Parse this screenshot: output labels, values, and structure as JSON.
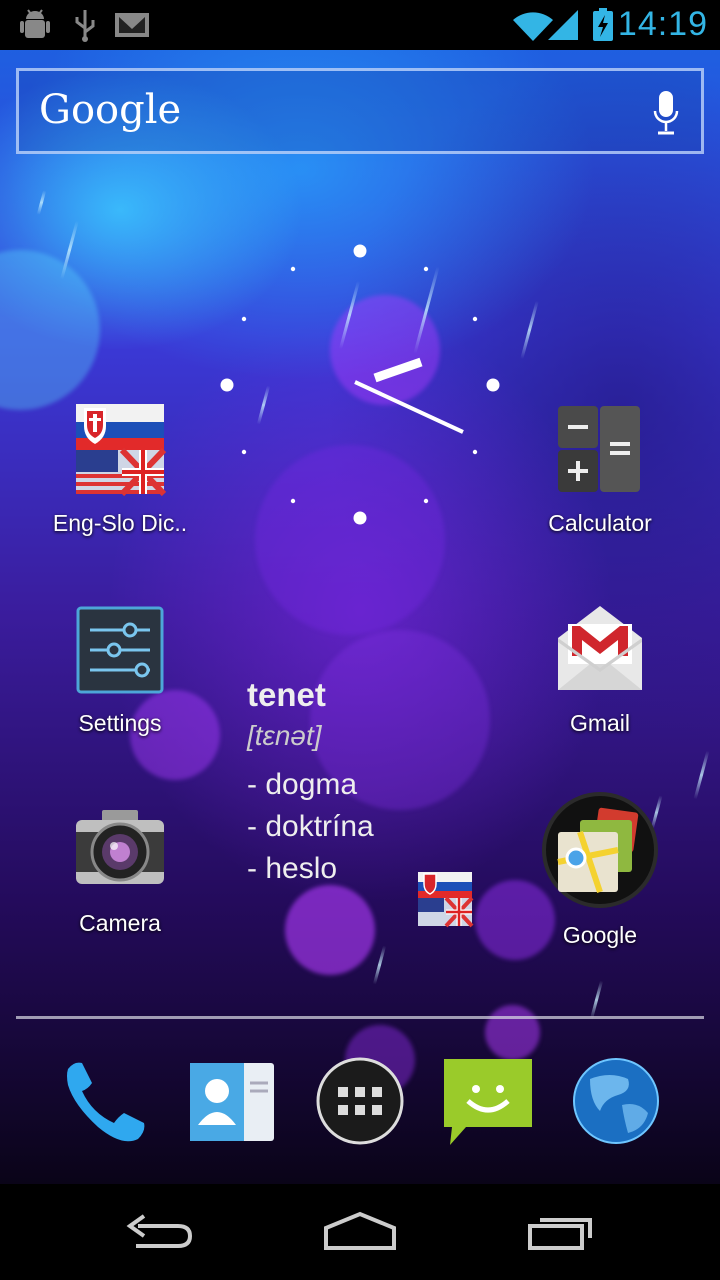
{
  "status_bar": {
    "time": "14:19",
    "left_icons": [
      "android-debug-icon",
      "usb-icon",
      "gmail-notification-icon"
    ],
    "right_icons": [
      "wifi-icon",
      "signal-icon",
      "battery-charging-icon"
    ],
    "accent_color": "#33b5e5"
  },
  "search": {
    "logo_text": "Google",
    "mic_icon": "microphone-icon"
  },
  "home_apps": [
    {
      "label": "Eng-Slo Dic..",
      "icon": "flag-dictionary-icon"
    },
    {
      "label": "Calculator",
      "icon": "calculator-icon"
    },
    {
      "label": "Settings",
      "icon": "settings-sliders-icon"
    },
    {
      "label": "Gmail",
      "icon": "gmail-envelope-icon"
    },
    {
      "label": "Camera",
      "icon": "camera-icon"
    },
    {
      "label": "Google",
      "icon": "google-folder-icon"
    }
  ],
  "dictionary_widget": {
    "word": "tenet",
    "pronunciation": "[tɛnət]",
    "translations": [
      "- dogma",
      "- doktrína",
      "- heslo"
    ]
  },
  "dock": [
    "phone-icon",
    "contacts-icon",
    "app-drawer-icon",
    "messaging-icon",
    "browser-globe-icon"
  ],
  "navigation": [
    "back-icon",
    "home-icon",
    "recent-apps-icon"
  ]
}
